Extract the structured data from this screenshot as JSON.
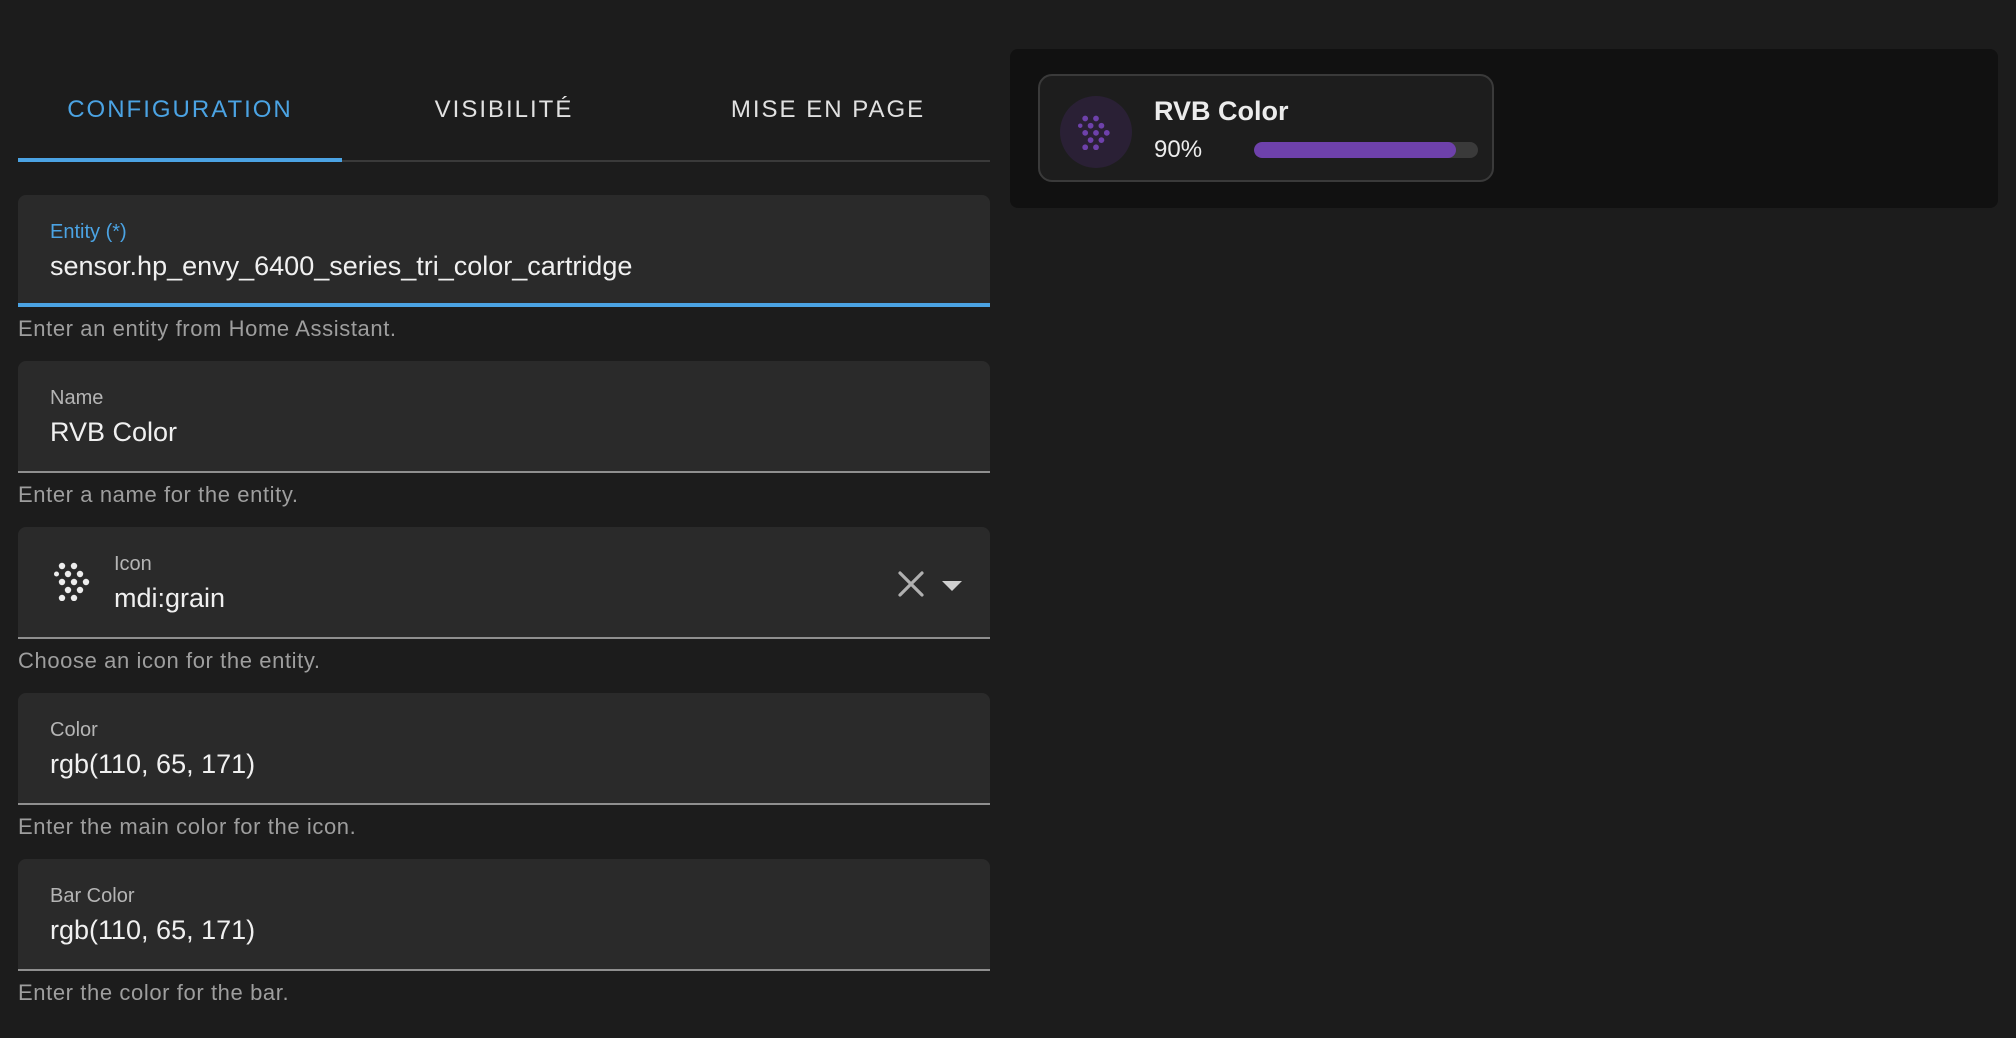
{
  "tabs": [
    {
      "label": "CONFIGURATION",
      "active": true
    },
    {
      "label": "VISIBILITÉ",
      "active": false
    },
    {
      "label": "MISE EN PAGE",
      "active": false
    }
  ],
  "fields": {
    "entity": {
      "label": "Entity (*)",
      "value": "sensor.hp_envy_6400_series_tri_color_cartridge",
      "helper": "Enter an entity from Home Assistant."
    },
    "name": {
      "label": "Name",
      "value": "RVB Color",
      "helper": "Enter a name for the entity."
    },
    "icon": {
      "label": "Icon",
      "value": "mdi:grain",
      "helper": "Choose an icon for the entity.",
      "icon": "grain-icon"
    },
    "color": {
      "label": "Color",
      "value": "rgb(110, 65, 171)",
      "helper": "Enter the main color for the icon."
    },
    "bar_color": {
      "label": "Bar Color",
      "value": "rgb(110, 65, 171)",
      "helper": "Enter the color for the bar."
    }
  },
  "preview": {
    "card": {
      "name": "RVB Color",
      "percent_text": "90%",
      "percent_value": 90,
      "icon": "grain-icon",
      "icon_color": "#6e41ab",
      "bar_color": "#6e41ab"
    }
  },
  "colors": {
    "accent": "#4ba3e3",
    "background": "#1c1c1c",
    "field_bg": "#2a2a2a",
    "preview_bg": "#111111"
  }
}
